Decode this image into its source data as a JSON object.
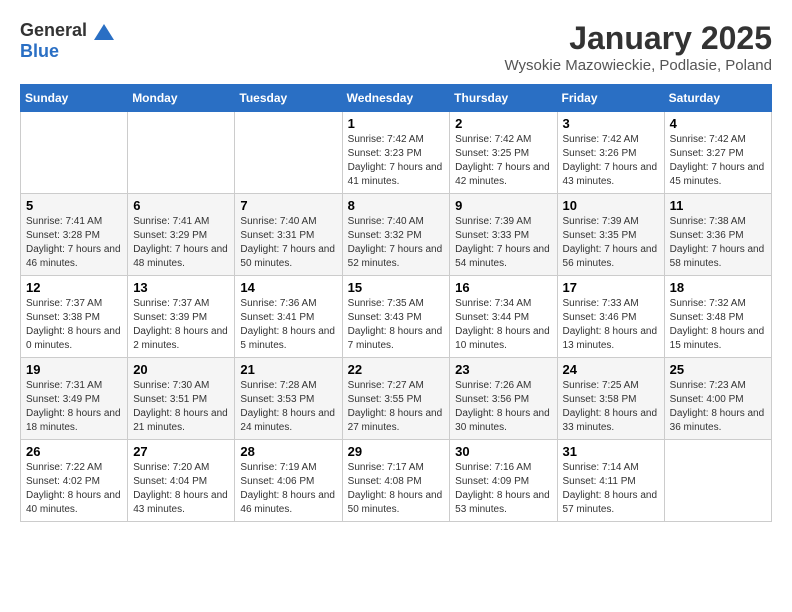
{
  "logo": {
    "text_general": "General",
    "text_blue": "Blue"
  },
  "title": "January 2025",
  "subtitle": "Wysokie Mazowieckie, Podlasie, Poland",
  "days_of_week": [
    "Sunday",
    "Monday",
    "Tuesday",
    "Wednesday",
    "Thursday",
    "Friday",
    "Saturday"
  ],
  "weeks": [
    [
      {
        "day": "",
        "sunrise": "",
        "sunset": "",
        "daylight": ""
      },
      {
        "day": "",
        "sunrise": "",
        "sunset": "",
        "daylight": ""
      },
      {
        "day": "",
        "sunrise": "",
        "sunset": "",
        "daylight": ""
      },
      {
        "day": "1",
        "sunrise": "Sunrise: 7:42 AM",
        "sunset": "Sunset: 3:23 PM",
        "daylight": "Daylight: 7 hours and 41 minutes."
      },
      {
        "day": "2",
        "sunrise": "Sunrise: 7:42 AM",
        "sunset": "Sunset: 3:25 PM",
        "daylight": "Daylight: 7 hours and 42 minutes."
      },
      {
        "day": "3",
        "sunrise": "Sunrise: 7:42 AM",
        "sunset": "Sunset: 3:26 PM",
        "daylight": "Daylight: 7 hours and 43 minutes."
      },
      {
        "day": "4",
        "sunrise": "Sunrise: 7:42 AM",
        "sunset": "Sunset: 3:27 PM",
        "daylight": "Daylight: 7 hours and 45 minutes."
      }
    ],
    [
      {
        "day": "5",
        "sunrise": "Sunrise: 7:41 AM",
        "sunset": "Sunset: 3:28 PM",
        "daylight": "Daylight: 7 hours and 46 minutes."
      },
      {
        "day": "6",
        "sunrise": "Sunrise: 7:41 AM",
        "sunset": "Sunset: 3:29 PM",
        "daylight": "Daylight: 7 hours and 48 minutes."
      },
      {
        "day": "7",
        "sunrise": "Sunrise: 7:40 AM",
        "sunset": "Sunset: 3:31 PM",
        "daylight": "Daylight: 7 hours and 50 minutes."
      },
      {
        "day": "8",
        "sunrise": "Sunrise: 7:40 AM",
        "sunset": "Sunset: 3:32 PM",
        "daylight": "Daylight: 7 hours and 52 minutes."
      },
      {
        "day": "9",
        "sunrise": "Sunrise: 7:39 AM",
        "sunset": "Sunset: 3:33 PM",
        "daylight": "Daylight: 7 hours and 54 minutes."
      },
      {
        "day": "10",
        "sunrise": "Sunrise: 7:39 AM",
        "sunset": "Sunset: 3:35 PM",
        "daylight": "Daylight: 7 hours and 56 minutes."
      },
      {
        "day": "11",
        "sunrise": "Sunrise: 7:38 AM",
        "sunset": "Sunset: 3:36 PM",
        "daylight": "Daylight: 7 hours and 58 minutes."
      }
    ],
    [
      {
        "day": "12",
        "sunrise": "Sunrise: 7:37 AM",
        "sunset": "Sunset: 3:38 PM",
        "daylight": "Daylight: 8 hours and 0 minutes."
      },
      {
        "day": "13",
        "sunrise": "Sunrise: 7:37 AM",
        "sunset": "Sunset: 3:39 PM",
        "daylight": "Daylight: 8 hours and 2 minutes."
      },
      {
        "day": "14",
        "sunrise": "Sunrise: 7:36 AM",
        "sunset": "Sunset: 3:41 PM",
        "daylight": "Daylight: 8 hours and 5 minutes."
      },
      {
        "day": "15",
        "sunrise": "Sunrise: 7:35 AM",
        "sunset": "Sunset: 3:43 PM",
        "daylight": "Daylight: 8 hours and 7 minutes."
      },
      {
        "day": "16",
        "sunrise": "Sunrise: 7:34 AM",
        "sunset": "Sunset: 3:44 PM",
        "daylight": "Daylight: 8 hours and 10 minutes."
      },
      {
        "day": "17",
        "sunrise": "Sunrise: 7:33 AM",
        "sunset": "Sunset: 3:46 PM",
        "daylight": "Daylight: 8 hours and 13 minutes."
      },
      {
        "day": "18",
        "sunrise": "Sunrise: 7:32 AM",
        "sunset": "Sunset: 3:48 PM",
        "daylight": "Daylight: 8 hours and 15 minutes."
      }
    ],
    [
      {
        "day": "19",
        "sunrise": "Sunrise: 7:31 AM",
        "sunset": "Sunset: 3:49 PM",
        "daylight": "Daylight: 8 hours and 18 minutes."
      },
      {
        "day": "20",
        "sunrise": "Sunrise: 7:30 AM",
        "sunset": "Sunset: 3:51 PM",
        "daylight": "Daylight: 8 hours and 21 minutes."
      },
      {
        "day": "21",
        "sunrise": "Sunrise: 7:28 AM",
        "sunset": "Sunset: 3:53 PM",
        "daylight": "Daylight: 8 hours and 24 minutes."
      },
      {
        "day": "22",
        "sunrise": "Sunrise: 7:27 AM",
        "sunset": "Sunset: 3:55 PM",
        "daylight": "Daylight: 8 hours and 27 minutes."
      },
      {
        "day": "23",
        "sunrise": "Sunrise: 7:26 AM",
        "sunset": "Sunset: 3:56 PM",
        "daylight": "Daylight: 8 hours and 30 minutes."
      },
      {
        "day": "24",
        "sunrise": "Sunrise: 7:25 AM",
        "sunset": "Sunset: 3:58 PM",
        "daylight": "Daylight: 8 hours and 33 minutes."
      },
      {
        "day": "25",
        "sunrise": "Sunrise: 7:23 AM",
        "sunset": "Sunset: 4:00 PM",
        "daylight": "Daylight: 8 hours and 36 minutes."
      }
    ],
    [
      {
        "day": "26",
        "sunrise": "Sunrise: 7:22 AM",
        "sunset": "Sunset: 4:02 PM",
        "daylight": "Daylight: 8 hours and 40 minutes."
      },
      {
        "day": "27",
        "sunrise": "Sunrise: 7:20 AM",
        "sunset": "Sunset: 4:04 PM",
        "daylight": "Daylight: 8 hours and 43 minutes."
      },
      {
        "day": "28",
        "sunrise": "Sunrise: 7:19 AM",
        "sunset": "Sunset: 4:06 PM",
        "daylight": "Daylight: 8 hours and 46 minutes."
      },
      {
        "day": "29",
        "sunrise": "Sunrise: 7:17 AM",
        "sunset": "Sunset: 4:08 PM",
        "daylight": "Daylight: 8 hours and 50 minutes."
      },
      {
        "day": "30",
        "sunrise": "Sunrise: 7:16 AM",
        "sunset": "Sunset: 4:09 PM",
        "daylight": "Daylight: 8 hours and 53 minutes."
      },
      {
        "day": "31",
        "sunrise": "Sunrise: 7:14 AM",
        "sunset": "Sunset: 4:11 PM",
        "daylight": "Daylight: 8 hours and 57 minutes."
      },
      {
        "day": "",
        "sunrise": "",
        "sunset": "",
        "daylight": ""
      }
    ]
  ]
}
